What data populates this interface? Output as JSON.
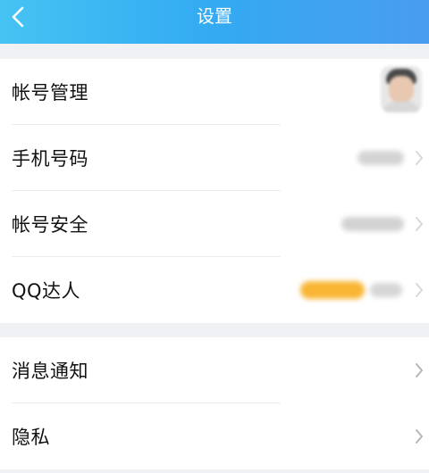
{
  "header": {
    "title": "设置"
  },
  "group1": {
    "items": [
      {
        "label": "帐号管理"
      },
      {
        "label": "手机号码"
      },
      {
        "label": "帐号安全"
      },
      {
        "label": "QQ达人"
      }
    ]
  },
  "group2": {
    "items": [
      {
        "label": "消息通知"
      },
      {
        "label": "隐私"
      }
    ]
  },
  "icons": {
    "back": "chevron-left-icon",
    "arrow": "chevron-right-icon"
  },
  "colors": {
    "header_start": "#46c3f2",
    "header_end": "#4a9cf1",
    "background": "#eff1f5",
    "chevron": "#b6b6b6",
    "highlight_badge": "#f9b635"
  }
}
